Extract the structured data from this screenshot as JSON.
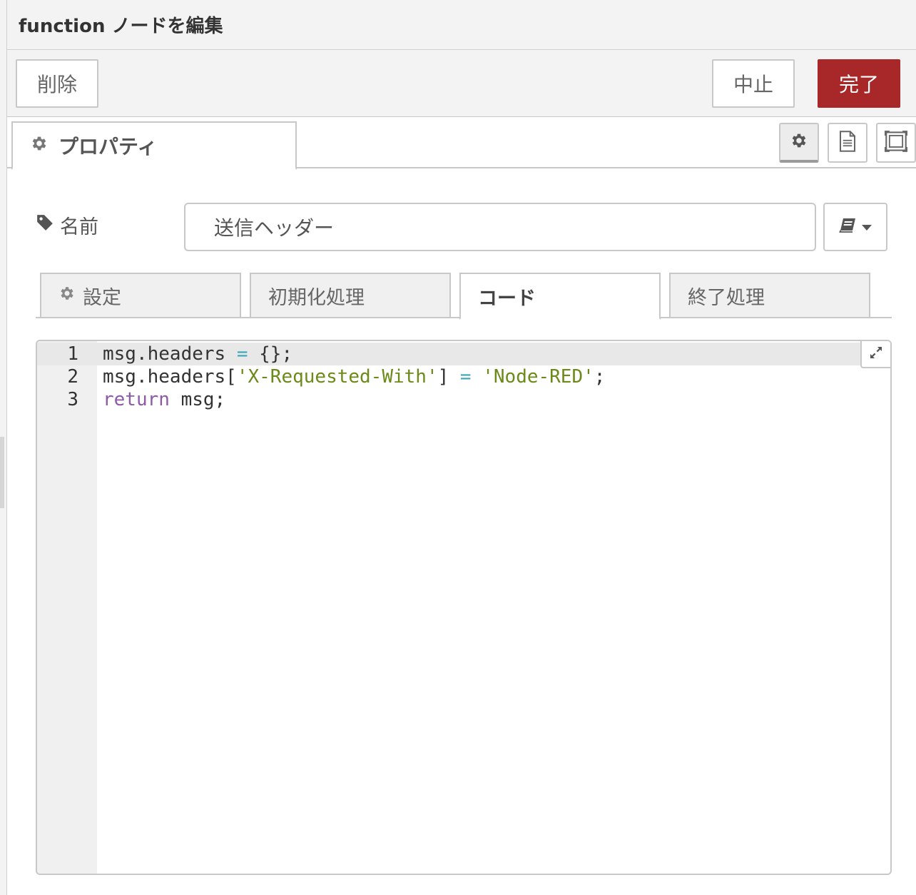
{
  "header": {
    "title": "function ノードを編集"
  },
  "toolbar": {
    "delete_label": "削除",
    "cancel_label": "中止",
    "done_label": "完了"
  },
  "tabs": {
    "properties_label": "プロパティ"
  },
  "name_field": {
    "label": "名前",
    "value": "送信ヘッダー"
  },
  "subtabs": [
    {
      "label": "設定"
    },
    {
      "label": "初期化処理"
    },
    {
      "label": "コード"
    },
    {
      "label": "終了処理"
    }
  ],
  "editor": {
    "line_numbers": [
      "1",
      "2",
      "3"
    ],
    "lines": [
      [
        {
          "t": "msg.headers "
        },
        {
          "t": "=",
          "c": "op"
        },
        {
          "t": " {};"
        }
      ],
      [
        {
          "t": "msg.headers["
        },
        {
          "t": "'X-Requested-With'",
          "c": "str"
        },
        {
          "t": "] "
        },
        {
          "t": "=",
          "c": "op"
        },
        {
          "t": " "
        },
        {
          "t": "'Node-RED'",
          "c": "str"
        },
        {
          "t": ";"
        }
      ],
      [
        {
          "t": "return",
          "c": "kw"
        },
        {
          "t": " msg;"
        }
      ]
    ]
  },
  "colors": {
    "done_button": "#a8282a",
    "string": "#6b8a18",
    "operator": "#3aa5b7",
    "keyword": "#8d5ba6"
  },
  "icons": [
    "cog-icon",
    "book-icon",
    "file-text-icon",
    "window-maximize-icon",
    "tag-icon",
    "expand-icon",
    "caret-down-icon"
  ]
}
